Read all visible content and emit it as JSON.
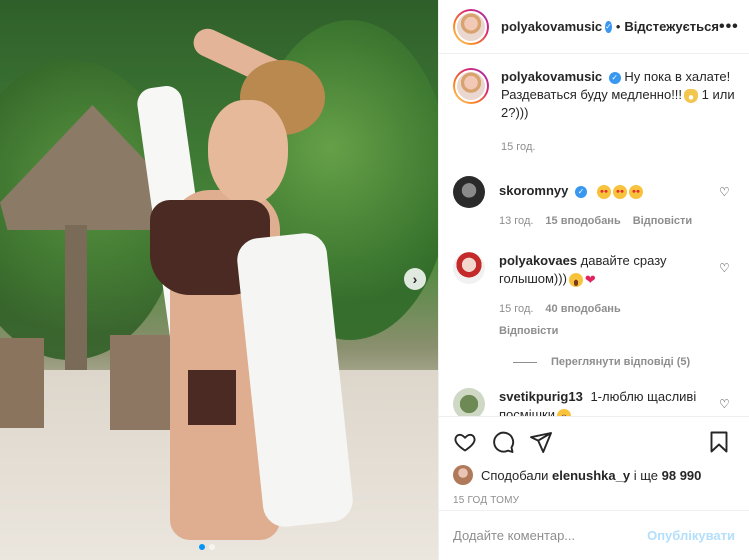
{
  "post": {
    "username": "polyakovamusic",
    "verified": true,
    "separator": "•",
    "follow_status": "Відстежується",
    "more_label": "•••",
    "carousel": {
      "total_slides": 2,
      "active_slide": 1,
      "next_label": "›"
    }
  },
  "caption": {
    "username": "polyakovamusic",
    "text": "Ну пока в халате! Раздеваться буду медленно!!!",
    "text_after": " 1 или 2?)))",
    "time": "15 год."
  },
  "comments": [
    {
      "username": "skoromnyy",
      "verified": true,
      "text": "",
      "emojis": [
        "starry-eyes-emoji",
        "starry-eyes-emoji",
        "starry-eyes-emoji"
      ],
      "time": "13 год.",
      "likes": "15 вподобань",
      "reply_label": "Відповісти"
    },
    {
      "username": "polyakovaes",
      "text": "давайте сразу голышом)))",
      "time": "15 год.",
      "likes": "40 вподобань",
      "reply_label": "Відповісти",
      "view_replies": "Переглянути відповіді (5)"
    },
    {
      "username": "svetikpurig13",
      "text": "1-люблю щасливі посмішки"
    }
  ],
  "likes": {
    "prefix": "Сподобали",
    "user": "elenushka_y",
    "middle": "і ще",
    "count": "98 990"
  },
  "time_ago": "15 ГОД ТОМУ",
  "comment_input": {
    "placeholder": "Додайте коментар...",
    "post_label": "Опублікувати"
  },
  "colors": {
    "verified_blue": "#3897f0",
    "link_blue": "#0095f6",
    "post_disabled": "#b2dffc",
    "heart_red": "#e0245e"
  }
}
